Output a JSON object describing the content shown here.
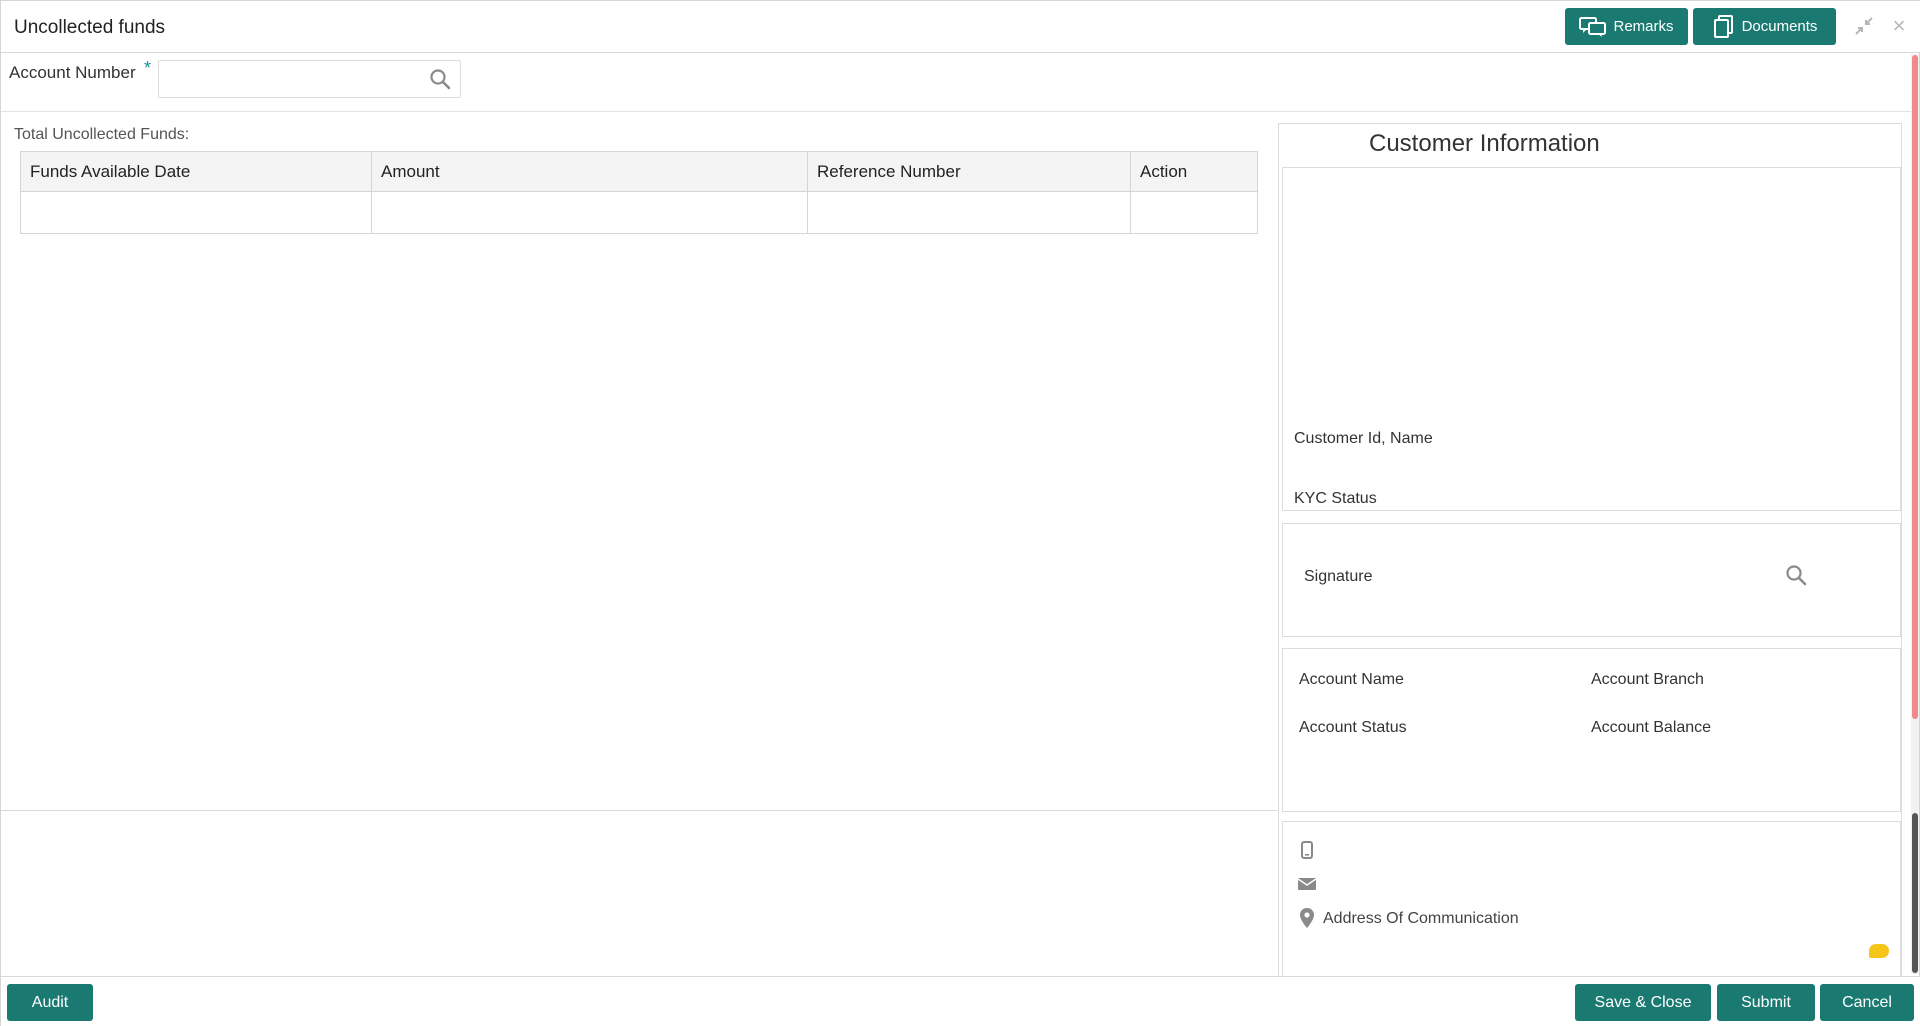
{
  "window": {
    "title": "Uncollected funds"
  },
  "header": {
    "remarks_label": "Remarks",
    "documents_label": "Documents",
    "minimize_icon": "collapse-arrows-icon",
    "close_symbol": "×"
  },
  "account_search": {
    "label": "Account Number",
    "required_mark": "*",
    "value": "",
    "placeholder": ""
  },
  "funds": {
    "total_label": "Total Uncollected Funds:",
    "columns": [
      "Funds Available Date",
      "Amount",
      "Reference Number",
      "Action"
    ],
    "rows": [
      [
        "",
        "",
        "",
        ""
      ]
    ]
  },
  "customer_info": {
    "title": "Customer Information",
    "customer_id_label": "Customer Id, Name",
    "kyc_label": "KYC Status",
    "signature_label": "Signature",
    "account_name_label": "Account Name",
    "account_branch_label": "Account Branch",
    "account_status_label": "Account Status",
    "account_balance_label": "Account Balance",
    "address_label": "Address Of Communication"
  },
  "footer": {
    "audit_label": "Audit",
    "save_close_label": "Save & Close",
    "submit_label": "Submit",
    "cancel_label": "Cancel"
  },
  "colors": {
    "primary_button": "#1a7a72",
    "scroll_thumb": "#ef8a8a",
    "required_star": "#1a8fa0",
    "chat_bubble": "#f5c518"
  }
}
